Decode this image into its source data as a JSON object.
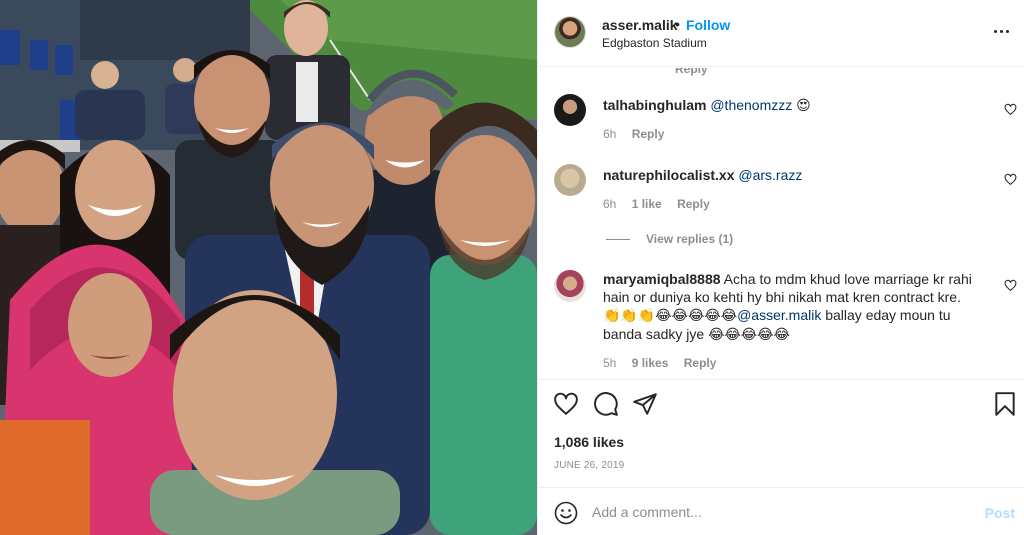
{
  "post": {
    "photo_alt": "Group selfie at a cricket stadium"
  },
  "header": {
    "username": "asser.malik",
    "dot": "•",
    "follow_label": "Follow",
    "location": "Edgbaston Stadium"
  },
  "comments": {
    "partial_reply": "Reply",
    "items": [
      {
        "username": "talhabinghulam",
        "mention": "@thenomzzz",
        "text": "",
        "emoji": "😍",
        "time": "6h",
        "likes": "",
        "reply_label": "Reply"
      },
      {
        "username": "naturephilocalist.xx",
        "mention": "@ars.razz",
        "text": "",
        "emoji": "",
        "time": "6h",
        "likes": "1 like",
        "reply_label": "Reply",
        "view_replies": "View replies (1)"
      },
      {
        "username": "maryamiqbal8888",
        "text_1": "Acha to mdm khud love marriage kr rahi hain or duniya ko kehti hy bhi nikah mat kren contract kre.",
        "emoji_1": "👏👏👏😂😂😂😂😂",
        "mention": "@asser.malik",
        "text_2": "ballay eday moun tu banda sadky jye",
        "emoji_2": "😂😂😂😂😂",
        "time": "5h",
        "likes": "9 likes",
        "reply_label": "Reply"
      }
    ]
  },
  "actions": {
    "like_icon": "heart-icon",
    "comment_icon": "comment-icon",
    "share_icon": "share-icon",
    "save_icon": "bookmark-icon",
    "likes_count": "1,086 likes",
    "date": "JUNE 26, 2019"
  },
  "add_comment": {
    "placeholder": "Add a comment...",
    "post_label": "Post"
  },
  "colors": {
    "accent": "#0095f6",
    "mention": "#00376b",
    "muted": "#8e8e8e",
    "post_disabled": "#b2dffc"
  }
}
